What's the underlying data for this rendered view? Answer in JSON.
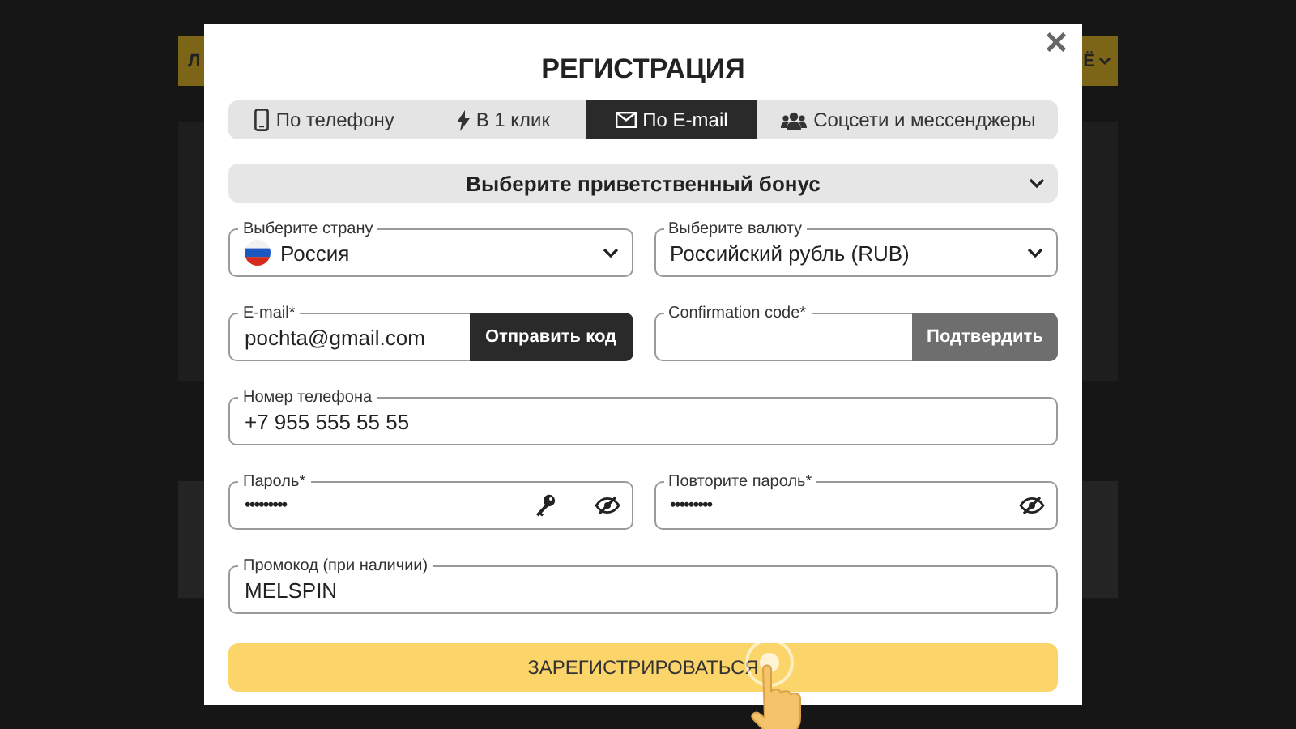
{
  "backdrop": {
    "nav_left": "Л",
    "nav_right": "Ё"
  },
  "modal": {
    "title": "РЕГИСТРАЦИЯ",
    "close": "×"
  },
  "tabs": [
    {
      "label": "По телефону",
      "selected": false
    },
    {
      "label": "В 1 клик",
      "selected": false
    },
    {
      "label": "По E-mail",
      "selected": true
    },
    {
      "label": "Соцсети и мессенджеры",
      "selected": false
    }
  ],
  "bonus": {
    "label": "Выберите приветственный бонус"
  },
  "rows": [
    [
      {
        "kind": "select",
        "label": "Выберите страну",
        "value": "Россия",
        "flag": true
      },
      {
        "kind": "select",
        "label": "Выберите валюту",
        "value": "Российский рубль (RUB)",
        "flag": false
      }
    ],
    [
      {
        "kind": "text",
        "label": "E-mail*",
        "value": "pochta@gmail.com",
        "button": {
          "label": "Отправить код",
          "disabled": false
        }
      },
      {
        "kind": "text",
        "label": "Confirmation code*",
        "button": {
          "label": "Подтвердить",
          "disabled": true
        }
      }
    ],
    [
      {
        "kind": "text",
        "label": "Номер телефона",
        "value": "+7 955 555 55 55"
      }
    ],
    [
      {
        "kind": "password",
        "label": "Пароль*",
        "value": "•••••••••",
        "key": true
      },
      {
        "kind": "password",
        "label": "Повторите пароль*",
        "value": "•••••••••",
        "key": false
      }
    ],
    [
      {
        "kind": "text",
        "label": "Промокод (при наличии)",
        "value": "MELSPIN"
      }
    ]
  ],
  "submit": {
    "label": "ЗАРЕГИСТРИРОВАТЬСЯ"
  }
}
